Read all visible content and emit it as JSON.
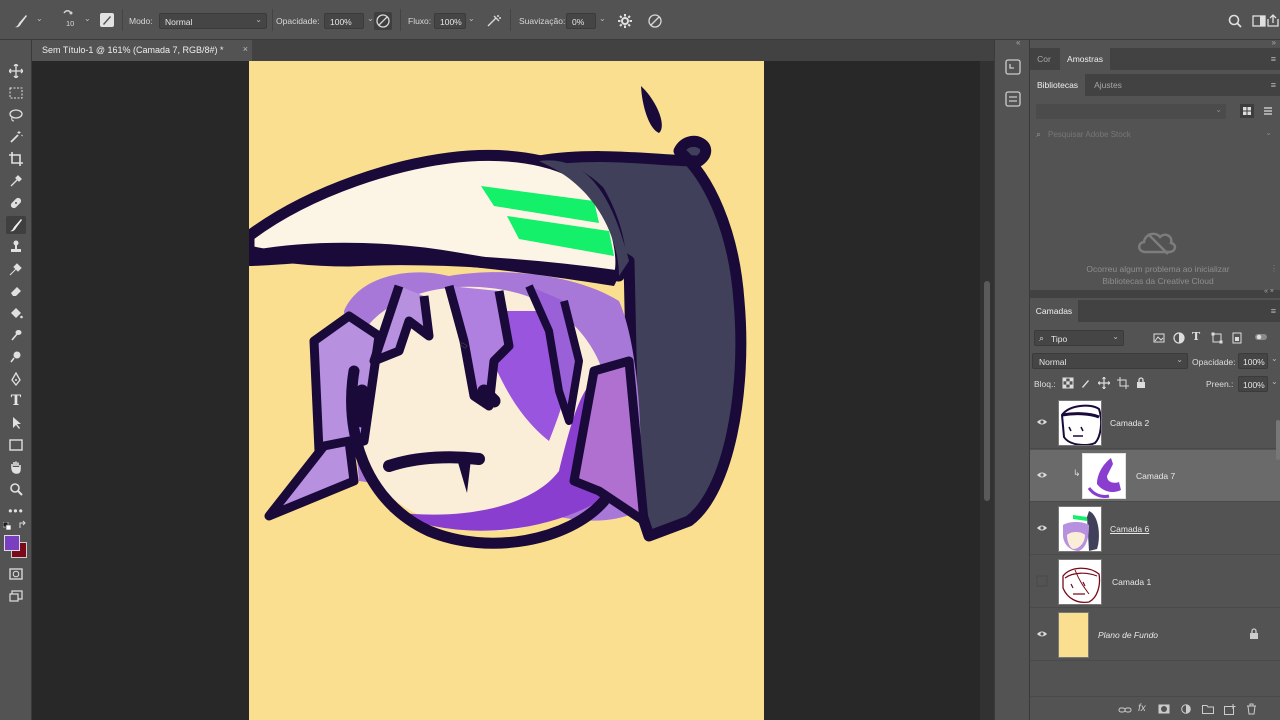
{
  "options_bar": {
    "brush_size": "10",
    "mode_label": "Modo:",
    "mode_value": "Normal",
    "opacity_label": "Opacidade:",
    "opacity_value": "100%",
    "flow_label": "Fluxo:",
    "flow_value": "100%",
    "smoothing_label": "Suavização:",
    "smoothing_value": "0%"
  },
  "document": {
    "tab_title": "Sem Título-1 @ 161% (Camada 7, RGB/8#) *",
    "close_glyph": "×",
    "background_color": "#fbdf90"
  },
  "colors": {
    "foreground": "#7a3fc0",
    "background": "#7a0a1a"
  },
  "panels": {
    "top_tabs": [
      "Cor",
      "Amostras"
    ],
    "library_tabs": [
      "Bibliotecas",
      "Ajustes"
    ],
    "library_search_placeholder": "Pesquisar Adobe Stock",
    "library_error": "Ocorreu algum problema ao inicializar Bibliotecas da Creative Cloud",
    "layers_tab": "Camadas"
  },
  "layers_panel": {
    "filter_kind": "Tipo",
    "blend_mode": "Normal",
    "opacity_label": "Opacidade:",
    "opacity_value": "100%",
    "lock_label": "Bloq.:",
    "fill_label": "Preen.:",
    "fill_value": "100%",
    "layers": [
      {
        "name": "Camada 2",
        "visible": true,
        "selected": false,
        "italic": false
      },
      {
        "name": "Camada 7",
        "visible": true,
        "selected": true,
        "italic": false
      },
      {
        "name": "Camada 6",
        "visible": true,
        "selected": false,
        "italic": false
      },
      {
        "name": "Camada 1",
        "visible": false,
        "selected": false,
        "italic": false
      },
      {
        "name": "Plano de Fundo",
        "visible": true,
        "selected": false,
        "italic": true
      }
    ]
  }
}
